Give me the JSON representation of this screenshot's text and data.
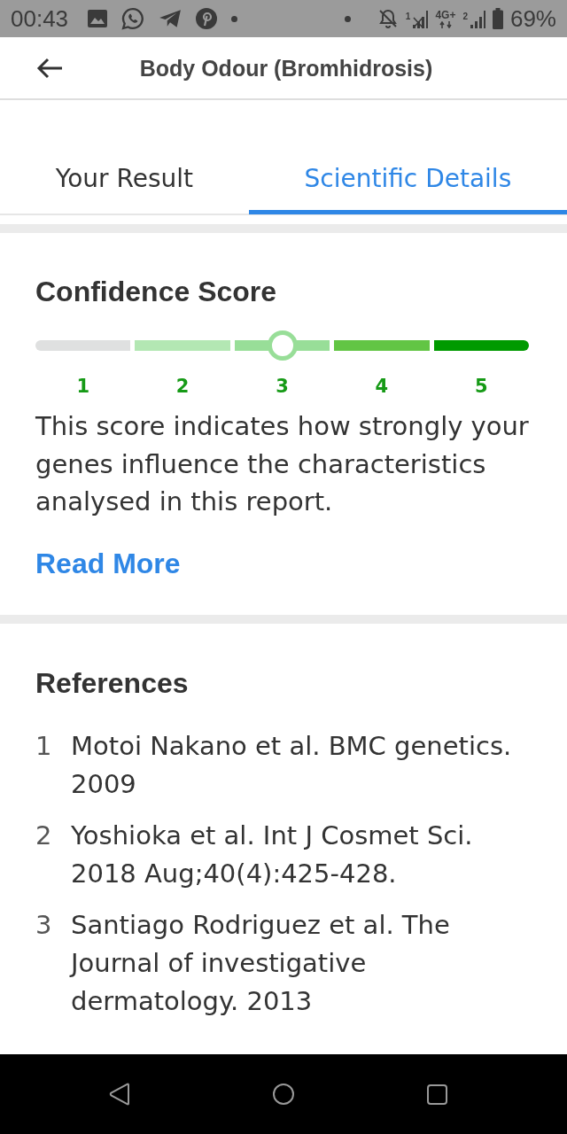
{
  "status_bar": {
    "time": "00:43",
    "sim_1": "1",
    "network": "4G+",
    "sim_2": "2",
    "battery": "69%"
  },
  "app_bar": {
    "title": "Body Odour (Bromhidrosis)"
  },
  "tabs": [
    {
      "label": "Your Result",
      "selected": false
    },
    {
      "label": "Scientific Details",
      "selected": true
    }
  ],
  "confidence": {
    "title": "Confidence Score",
    "segments": [
      {
        "label": "1",
        "color": "#dfe0e0",
        "selected": false
      },
      {
        "label": "2",
        "color": "#b3e7b3",
        "selected": false
      },
      {
        "label": "3",
        "color": "#98de98",
        "selected": true
      },
      {
        "label": "4",
        "color": "#62c544",
        "selected": false
      },
      {
        "label": "5",
        "color": "#009a00",
        "selected": false
      }
    ],
    "description": "This score indicates how strongly your genes influence the characteristics analysed in this report.",
    "link": "Read More"
  },
  "references": {
    "title": "References",
    "items": [
      {
        "number": "1",
        "text": "Motoi Nakano et al. BMC genetics. 2009"
      },
      {
        "number": "2",
        "text": "Yoshioka et al. Int J Cosmet Sci. 2018 Aug;40(4):425-428."
      },
      {
        "number": "3",
        "text": "Santiago Rodriguez et al. The Journal of investigative dermatology. 2013"
      }
    ]
  }
}
